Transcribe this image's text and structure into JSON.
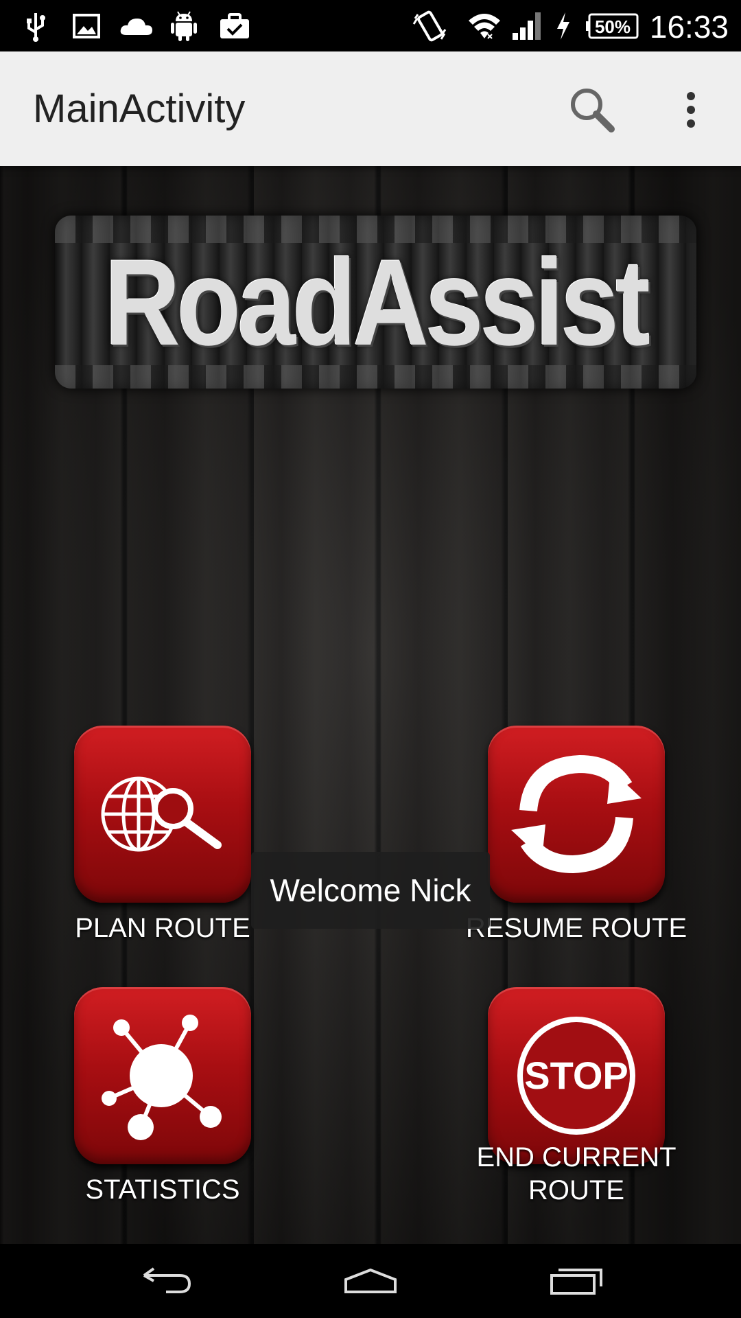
{
  "status_bar": {
    "icons_left": [
      "usb-icon",
      "image-icon",
      "cloud-icon",
      "android-icon",
      "briefcase-check-icon"
    ],
    "icons_right": [
      "vibrate-icon",
      "wifi-icon",
      "signal-icon",
      "charging-icon",
      "battery-icon"
    ],
    "battery": "50%",
    "time": "16:33"
  },
  "app_bar": {
    "title": "MainActivity",
    "search_icon": "search-icon",
    "overflow_icon": "overflow-menu-icon"
  },
  "logo": {
    "text": "RoadAssist"
  },
  "tiles": {
    "plan_route": {
      "label": "PLAN ROUTE",
      "icon": "globe-search-icon"
    },
    "resume_route": {
      "label": "RESUME ROUTE",
      "icon": "refresh-arrows-icon"
    },
    "statistics": {
      "label": "STATISTICS",
      "icon": "network-nodes-icon"
    },
    "end_route": {
      "label": "END CURRENT\nROUTE",
      "icon": "stop-sign-icon",
      "icon_text": "STOP"
    }
  },
  "toast": {
    "message": "Welcome Nick"
  },
  "nav_bar": {
    "back_icon": "back-icon",
    "home_icon": "home-icon",
    "recents_icon": "recents-icon"
  },
  "colors": {
    "tile_red": "#b01217",
    "app_bar_bg": "#efefef",
    "status_bar_bg": "#000000"
  }
}
